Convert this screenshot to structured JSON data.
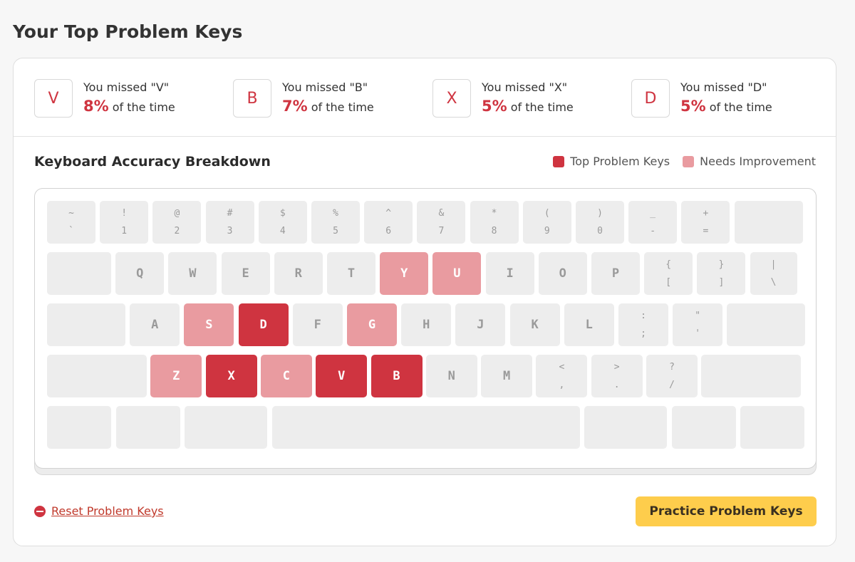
{
  "page": {
    "title": "Your Top Problem Keys"
  },
  "stats": [
    {
      "key": "V",
      "line1": "You missed \"V\"",
      "pct": "8%",
      "suffix": "of the time"
    },
    {
      "key": "B",
      "line1": "You missed \"B\"",
      "pct": "7%",
      "suffix": "of the time"
    },
    {
      "key": "X",
      "line1": "You missed \"X\"",
      "pct": "5%",
      "suffix": "of the time"
    },
    {
      "key": "D",
      "line1": "You missed \"D\"",
      "pct": "5%",
      "suffix": "of the time"
    }
  ],
  "breakdown": {
    "title": "Keyboard Accuracy Breakdown",
    "legend": {
      "top": "Top Problem Keys",
      "needs": "Needs Improvement"
    },
    "colors": {
      "top": "#cf3440",
      "needs": "#e99ba0",
      "normal": "#ededed"
    }
  },
  "keyboard": {
    "rows": [
      [
        {
          "top": "~",
          "bot": "`"
        },
        {
          "top": "!",
          "bot": "1"
        },
        {
          "top": "@",
          "bot": "2"
        },
        {
          "top": "#",
          "bot": "3"
        },
        {
          "top": "$",
          "bot": "4"
        },
        {
          "top": "%",
          "bot": "5"
        },
        {
          "top": "^",
          "bot": "6"
        },
        {
          "top": "&",
          "bot": "7"
        },
        {
          "top": "*",
          "bot": "8"
        },
        {
          "top": "(",
          "bot": "9"
        },
        {
          "top": ")",
          "bot": "0"
        },
        {
          "top": "_",
          "bot": "-"
        },
        {
          "top": "+",
          "bot": "="
        },
        {
          "top": "",
          "bot": ""
        }
      ],
      [
        {
          "main": ""
        },
        {
          "main": "Q"
        },
        {
          "main": "W"
        },
        {
          "main": "E"
        },
        {
          "main": "R"
        },
        {
          "main": "T"
        },
        {
          "main": "Y",
          "status": "needs"
        },
        {
          "main": "U",
          "status": "needs"
        },
        {
          "main": "I"
        },
        {
          "main": "O"
        },
        {
          "main": "P"
        },
        {
          "top": "{",
          "bot": "["
        },
        {
          "top": "}",
          "bot": "]"
        },
        {
          "top": "|",
          "bot": "\\"
        }
      ],
      [
        {
          "main": ""
        },
        {
          "main": "A"
        },
        {
          "main": "S",
          "status": "needs"
        },
        {
          "main": "D",
          "status": "top"
        },
        {
          "main": "F"
        },
        {
          "main": "G",
          "status": "needs"
        },
        {
          "main": "H"
        },
        {
          "main": "J"
        },
        {
          "main": "K"
        },
        {
          "main": "L"
        },
        {
          "top": ":",
          "bot": ";"
        },
        {
          "top": "\"",
          "bot": "'"
        },
        {
          "main": ""
        }
      ],
      [
        {
          "main": ""
        },
        {
          "main": "Z",
          "status": "needs"
        },
        {
          "main": "X",
          "status": "top"
        },
        {
          "main": "C",
          "status": "needs"
        },
        {
          "main": "V",
          "status": "top"
        },
        {
          "main": "B",
          "status": "top"
        },
        {
          "main": "N"
        },
        {
          "main": "M"
        },
        {
          "top": "<",
          "bot": ","
        },
        {
          "top": ">",
          "bot": "."
        },
        {
          "top": "?",
          "bot": "/"
        },
        {
          "main": ""
        }
      ],
      [
        {
          "main": ""
        },
        {
          "main": ""
        },
        {
          "main": ""
        },
        {
          "main": ""
        },
        {
          "main": ""
        },
        {
          "main": ""
        },
        {
          "main": ""
        }
      ]
    ]
  },
  "actions": {
    "reset_label": "Reset Problem Keys",
    "practice_label": "Practice Problem Keys"
  }
}
